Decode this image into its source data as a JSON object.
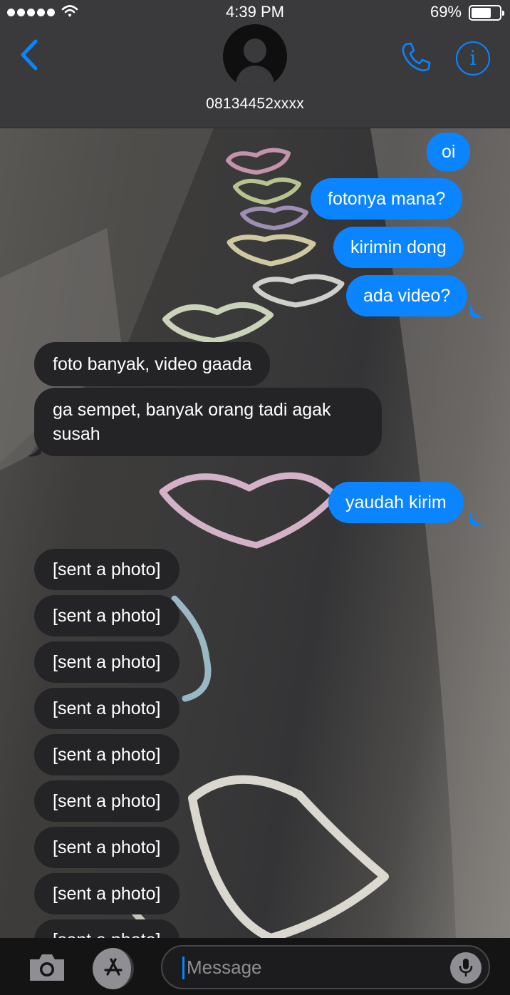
{
  "status_bar": {
    "time": "4:39 PM",
    "battery": "69%",
    "battery_level": 0.69,
    "signal_dots": 5
  },
  "header": {
    "contact": "08134452xxxx",
    "icons": {
      "back": "chevron-left-icon",
      "call": "phone-icon",
      "info": "info-icon",
      "avatar": "person-silhouette-icon"
    },
    "accent": "#0a84ff"
  },
  "messages": [
    {
      "dir": "out",
      "text": "oi"
    },
    {
      "dir": "out",
      "text": "fotonya mana?"
    },
    {
      "dir": "out",
      "text": "kirimin dong"
    },
    {
      "dir": "out",
      "text": "ada video?"
    },
    {
      "dir": "in",
      "text": "foto banyak, video gaada"
    },
    {
      "dir": "in",
      "lines": [
        "ga sempet, banyak orang tadi agak",
        "susah"
      ]
    },
    {
      "dir": "out",
      "text": "yaudah kirim"
    },
    {
      "dir": "in",
      "text": "[sent a photo]"
    },
    {
      "dir": "in",
      "text": "[sent a photo]"
    },
    {
      "dir": "in",
      "text": "[sent a photo]"
    },
    {
      "dir": "in",
      "text": "[sent a photo]"
    },
    {
      "dir": "in",
      "text": "[sent a photo]"
    },
    {
      "dir": "in",
      "text": "[sent a photo]"
    },
    {
      "dir": "in",
      "text": "[sent a photo]"
    },
    {
      "dir": "in",
      "text": "[sent a photo]"
    },
    {
      "dir": "in",
      "text": "[sent a photo]"
    }
  ],
  "input": {
    "placeholder": "Message",
    "icons": {
      "camera": "camera-icon",
      "apps": "app-store-icon",
      "mic": "microphone-icon"
    }
  },
  "colors": {
    "outgoing": "#0a84ff",
    "incoming": "#242427",
    "bar": "#3a3a3c"
  }
}
